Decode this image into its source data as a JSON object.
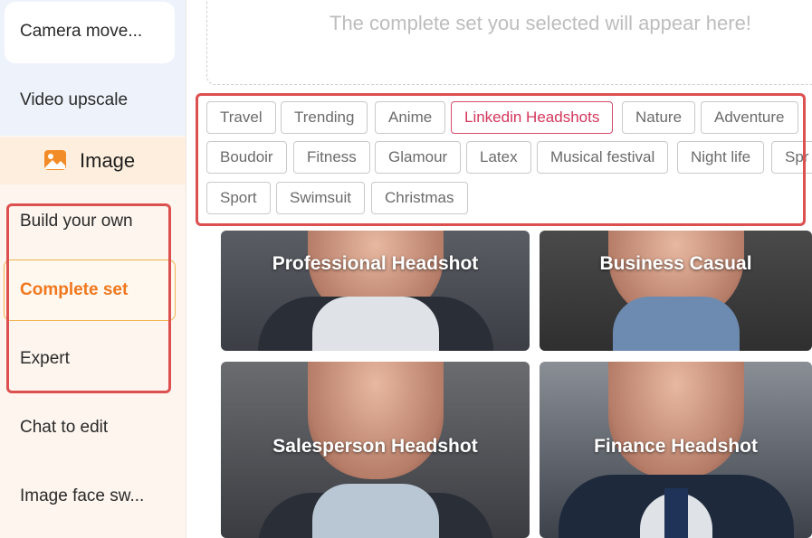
{
  "sidebar": {
    "items": [
      {
        "label": "Camera move..."
      },
      {
        "label": "Video upscale"
      },
      {
        "label": "Image"
      },
      {
        "label": "Build your own"
      },
      {
        "label": "Complete set"
      },
      {
        "label": "Expert"
      },
      {
        "label": "Chat to edit"
      },
      {
        "label": "Image face sw..."
      }
    ]
  },
  "dropzone": {
    "text": "The complete set you selected will appear here!"
  },
  "tags": [
    "Travel",
    "Trending",
    "Anime",
    "Linkedin Headshots",
    "Nature",
    "Adventure",
    "Boudoir",
    "Fitness",
    "Glamour",
    "Latex",
    "Musical festival",
    "Night life",
    "Spr",
    "Sport",
    "Swimsuit",
    "Christmas"
  ],
  "active_tag": "Linkedin Headshots",
  "cards": [
    {
      "title": "Professional Headshot"
    },
    {
      "title": "Business Casual"
    },
    {
      "title": "Salesperson Headshot"
    },
    {
      "title": "Finance Headshot"
    }
  ],
  "colors": {
    "accent": "#f0771e",
    "highlight": "#dd5050",
    "active_tag": "#d4365c"
  }
}
